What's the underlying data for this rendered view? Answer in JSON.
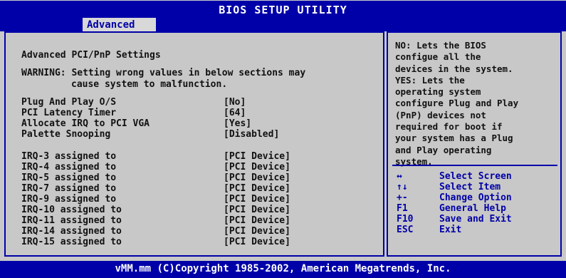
{
  "header": {
    "title": "BIOS SETUP UTILITY",
    "tab_label": "Advanced"
  },
  "main": {
    "heading": "Advanced PCI/PnP Settings",
    "warning_line1": "WARNING: Setting wrong values in below sections may",
    "warning_line2": "cause system to malfunction.",
    "settings": [
      {
        "label": "Plug And Play O/S",
        "value": "[No]"
      },
      {
        "label": "PCI Latency Timer",
        "value": "[64]"
      },
      {
        "label": "Allocate IRQ to PCI VGA",
        "value": "[Yes]"
      },
      {
        "label": "Palette Snooping",
        "value": "[Disabled]"
      }
    ],
    "irqs": [
      {
        "label": "IRQ-3 assigned to",
        "value": "[PCI Device]"
      },
      {
        "label": "IRQ-4 assigned to",
        "value": "[PCI Device]"
      },
      {
        "label": "IRQ-5 assigned to",
        "value": "[PCI Device]"
      },
      {
        "label": "IRQ-7 assigned to",
        "value": "[PCI Device]"
      },
      {
        "label": "IRQ-9 assigned to",
        "value": "[PCI Device]"
      },
      {
        "label": "IRQ-10 assigned to",
        "value": "[PCI Device]"
      },
      {
        "label": "IRQ-11 assigned to",
        "value": "[PCI Device]"
      },
      {
        "label": "IRQ-14 assigned to",
        "value": "[PCI Device]"
      },
      {
        "label": "IRQ-15 assigned to",
        "value": "[PCI Device]"
      }
    ]
  },
  "help": {
    "text": "NO: Lets the BIOS\nconfigue all the\ndevices in the system.\nYES: Lets the\noperating system\nconfigure Plug and Play\n(PnP) devices not\nrequired for boot if\nyour system has a Plug\nand Play operating\nsystem.",
    "keys": [
      {
        "key": "↔",
        "desc": "Select Screen",
        "icon": "left-right-arrow-icon"
      },
      {
        "key": "↑↓",
        "desc": "Select Item",
        "icon": "up-down-arrow-icon"
      },
      {
        "key": "+-",
        "desc": "Change Option",
        "icon": "plus-minus-icon"
      },
      {
        "key": "F1",
        "desc": "General Help",
        "icon": ""
      },
      {
        "key": "F10",
        "desc": "Save and Exit",
        "icon": ""
      },
      {
        "key": "ESC",
        "desc": "Exit",
        "icon": ""
      }
    ]
  },
  "footer": {
    "copyright": "vMM.mm (C)Copyright 1985-2002, American Megatrends, Inc."
  },
  "colors": {
    "background": "#0000a8",
    "panel": "#c8c8c8",
    "text": "#111111",
    "accent": "#0000a8"
  }
}
